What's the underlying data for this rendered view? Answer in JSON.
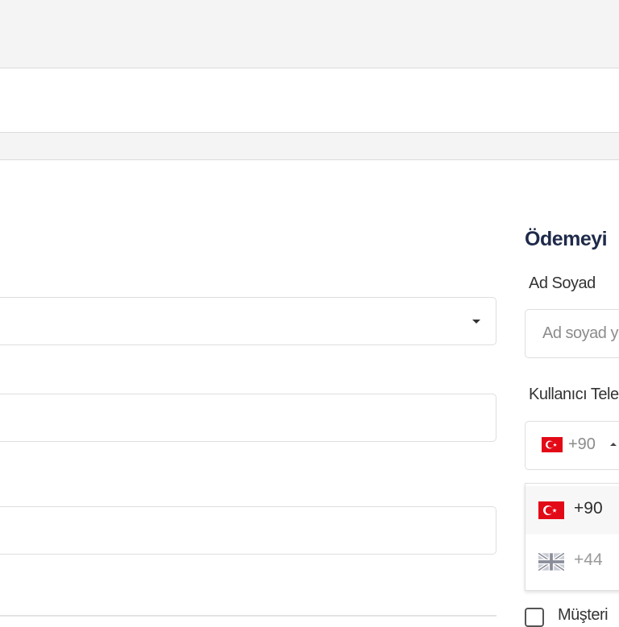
{
  "checkout": {
    "title": "Ödemeyi",
    "name_field": {
      "label": "Ad Soyad",
      "placeholder": "Ad soyad y"
    },
    "phone_field": {
      "label": "Kullanıcı Tele",
      "selected_code": "+90",
      "selected_flag": "turkey-flag-icon"
    },
    "country_dropdown": {
      "options": [
        {
          "flag": "turkey-flag-icon",
          "code": "+90"
        },
        {
          "flag": "uk-flag-icon",
          "code": "+44"
        }
      ]
    },
    "checkbox_label": "Müşteri"
  },
  "colors": {
    "title": "#1f2a4a",
    "border": "#dedede",
    "placeholder": "#8c8c8c",
    "turkey_red": "#e30a17"
  }
}
